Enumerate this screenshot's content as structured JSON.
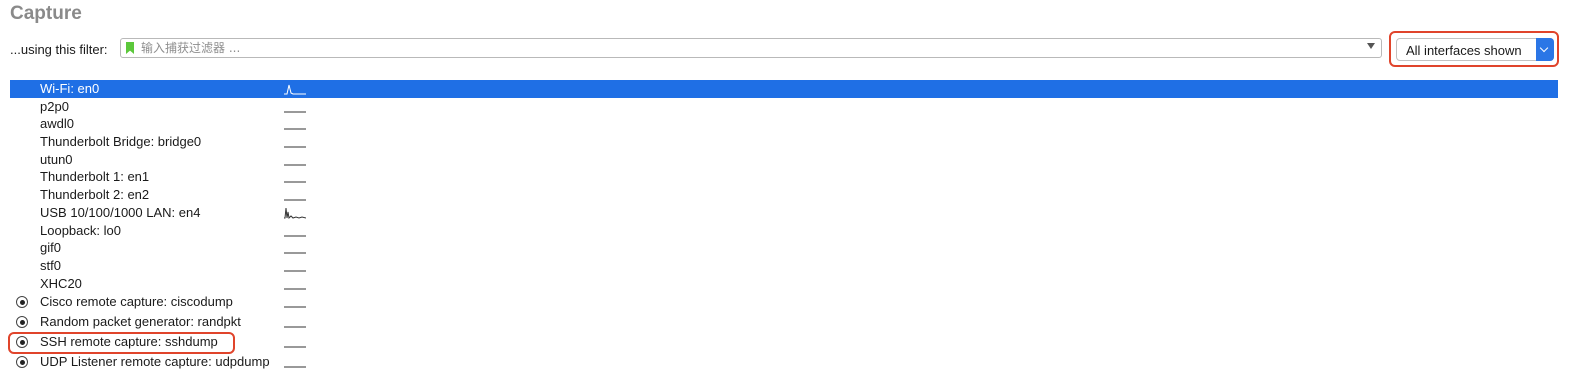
{
  "section": {
    "title": "Capture"
  },
  "filter": {
    "label": "...using this filter:",
    "placeholder": "输入捕获过滤器 ..."
  },
  "interface_selector": {
    "value": "All interfaces shown"
  },
  "interfaces": [
    {
      "name": "Wi-Fi: en0",
      "selected": true,
      "spark": "peak"
    },
    {
      "name": "p2p0",
      "spark": "flat"
    },
    {
      "name": "awdl0",
      "spark": "flat"
    },
    {
      "name": "Thunderbolt Bridge: bridge0",
      "spark": "flat"
    },
    {
      "name": "utun0",
      "spark": "flat"
    },
    {
      "name": "Thunderbolt 1: en1",
      "spark": "flat"
    },
    {
      "name": "Thunderbolt 2: en2",
      "spark": "flat"
    },
    {
      "name": "USB 10/100/1000 LAN: en4",
      "spark": "busy"
    },
    {
      "name": "Loopback: lo0",
      "spark": "flat"
    },
    {
      "name": "gif0",
      "spark": "flat"
    },
    {
      "name": "stf0",
      "spark": "flat"
    },
    {
      "name": "XHC20",
      "spark": "flat"
    },
    {
      "name": "Cisco remote capture: ciscodump",
      "extcap": true,
      "spark": "flat"
    },
    {
      "name": "Random packet generator: randpkt",
      "extcap": true,
      "spark": "flat"
    },
    {
      "name": "SSH remote capture: sshdump",
      "extcap": true,
      "spark": "flat",
      "highlighted": true
    },
    {
      "name": "UDP Listener remote capture: udpdump",
      "extcap": true,
      "spark": "flat"
    }
  ],
  "colors": {
    "selection": "#1f6fe5",
    "highlight": "#e0442b",
    "bookmark": "#5cc83b"
  }
}
